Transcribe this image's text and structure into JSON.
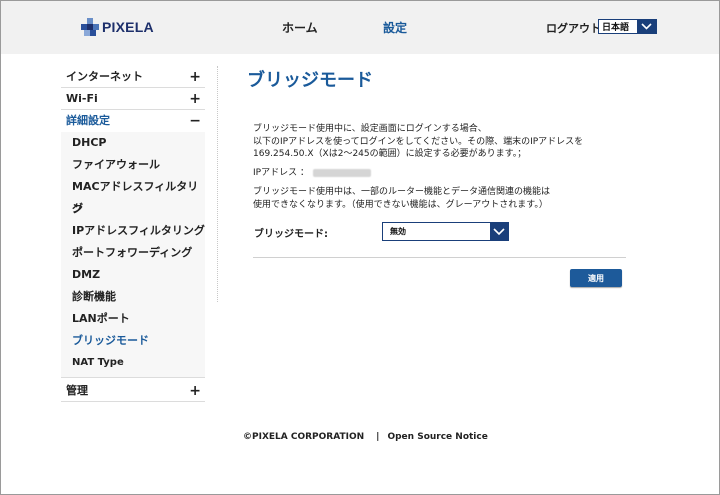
{
  "header": {
    "logo_text": "PIXELA",
    "nav": {
      "home": "ホーム",
      "settings": "設定"
    },
    "logout": "ログアウト",
    "language": {
      "selected": "日本語"
    }
  },
  "sidebar": {
    "internet": {
      "label": "インターネット",
      "toggle": "+"
    },
    "wifi": {
      "label": "Wi-Fi",
      "toggle": "+"
    },
    "advanced": {
      "label": "詳細設定",
      "toggle": "−",
      "items": [
        "DHCP",
        "ファイアウォール",
        "MACアドレスフィルタリン",
        "グ",
        "IPアドレスフィルタリング",
        "ポートフォワーディング",
        "DMZ",
        "診断機能",
        "LANポート",
        "ブリッジモード",
        "NAT Type"
      ]
    },
    "admin": {
      "label": "管理",
      "toggle": "+"
    }
  },
  "main": {
    "title": "ブリッジモード",
    "para1": [
      "ブリッジモード使用中に、設定画面にログインする場合、",
      "以下のIPアドレスを使ってログインをしてください。その際、端末のIPアドレスを",
      "169.254.50.X（Xは2～245の範囲）に設定する必要があります。；"
    ],
    "ip_label": "IPアドレス ：",
    "para2": [
      "ブリッジモード使用中は、一部のルーター機能とデータ通信関連の機能は",
      "使用できなくなります。（使用できない機能は、グレーアウトされます。）"
    ],
    "bridge_label": "ブリッジモード:",
    "bridge_value": "無効",
    "apply": "適用"
  },
  "footer": {
    "copyright": "©PIXELA  CORPORATION",
    "separator": "|",
    "oss": "Open Source Notice"
  },
  "colors": {
    "accent": "#1a5a9a",
    "select_border": "#1a3f7a",
    "button": "#1d5a9a"
  }
}
